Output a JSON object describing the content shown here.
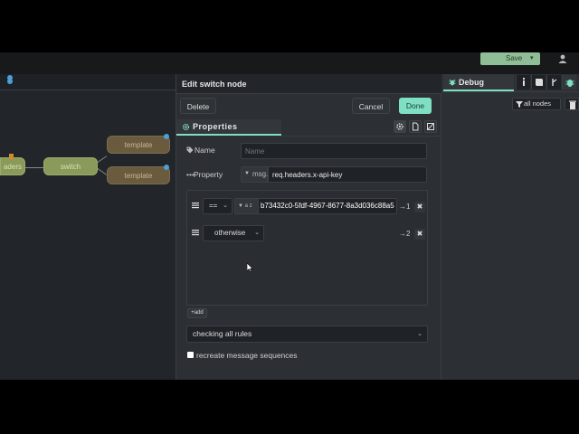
{
  "header": {
    "deploy_label": "Save"
  },
  "canvas": {
    "nodes": {
      "headers_label": "aders",
      "switch_label": "switch",
      "template1_label": "template",
      "template2_label": "template"
    }
  },
  "tray": {
    "title": "Edit switch node",
    "delete_label": "Delete",
    "cancel_label": "Cancel",
    "done_label": "Done",
    "properties_tab": "Properties",
    "name": {
      "label": "Name",
      "placeholder": "Name",
      "value": ""
    },
    "property": {
      "label": "Property",
      "type": "msg.",
      "value": "req.headers.x-api-key"
    },
    "rules": [
      {
        "operator": "==",
        "value_type": "a z",
        "value": "b73432c0-5fdf-4967-8677-8a3d036c88a5",
        "output": "→1"
      },
      {
        "operator": "otherwise",
        "output": "→2"
      }
    ],
    "add_label": "add",
    "check_mode": "checking all rules",
    "recreate_label": "recreate message sequences",
    "recreate_checked": false
  },
  "sidebar": {
    "tab_label": "Debug",
    "filter_label": "all nodes"
  },
  "colors": {
    "accent": "#7fe0c1",
    "deploy": "#8fbd95",
    "switch_node": "#8a9a5a",
    "template_node": "#6a5b3f",
    "port": "#4d9fd6"
  }
}
